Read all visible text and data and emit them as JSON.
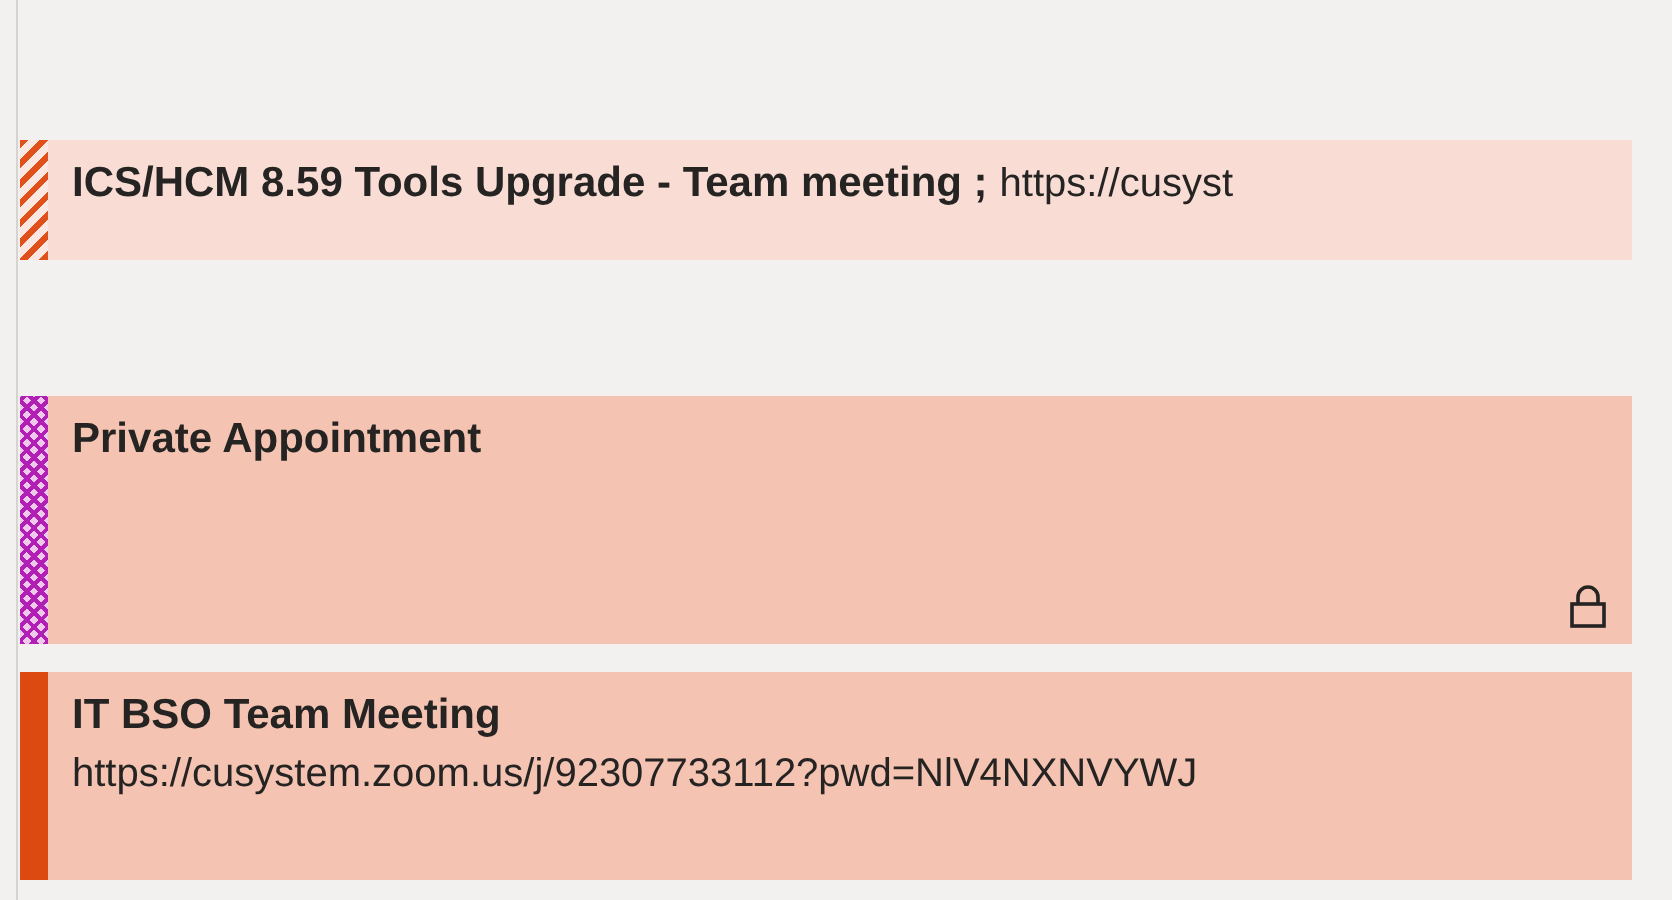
{
  "events": [
    {
      "kind": "tentative",
      "title": "ICS/HCM 8.59 Tools Upgrade - Team meeting ;",
      "location": "https://cusyst",
      "private": false
    },
    {
      "kind": "private",
      "title": "Private Appointment",
      "private": true
    },
    {
      "kind": "busy",
      "title": "IT BSO Team Meeting",
      "location": "https://cusystem.zoom.us/j/92307733112?pwd=NlV4NXNVYWJ",
      "private": false
    }
  ]
}
